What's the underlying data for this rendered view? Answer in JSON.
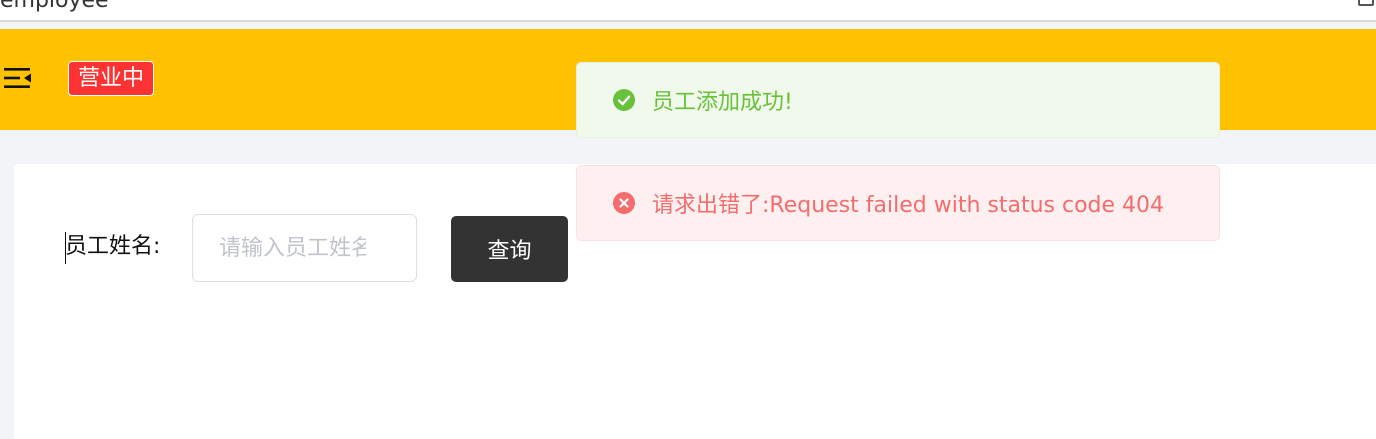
{
  "browser": {
    "tab_title": "employee"
  },
  "header": {
    "menu_icon": "menu-fold-icon",
    "status_badge": "营业中",
    "colors": {
      "header_bg": "#ffc200",
      "badge_bg": "#fd3333"
    }
  },
  "search": {
    "label": "员工姓名:",
    "placeholder": "请输入员工姓名",
    "value": "",
    "button_label": "查询"
  },
  "notifications": [
    {
      "type": "success",
      "icon": "check-circle-icon",
      "message": "员工添加成功!",
      "color": "#67c23a"
    },
    {
      "type": "error",
      "icon": "close-circle-icon",
      "message": "请求出错了:Request failed with status code 404",
      "color": "#f56c6c"
    }
  ]
}
